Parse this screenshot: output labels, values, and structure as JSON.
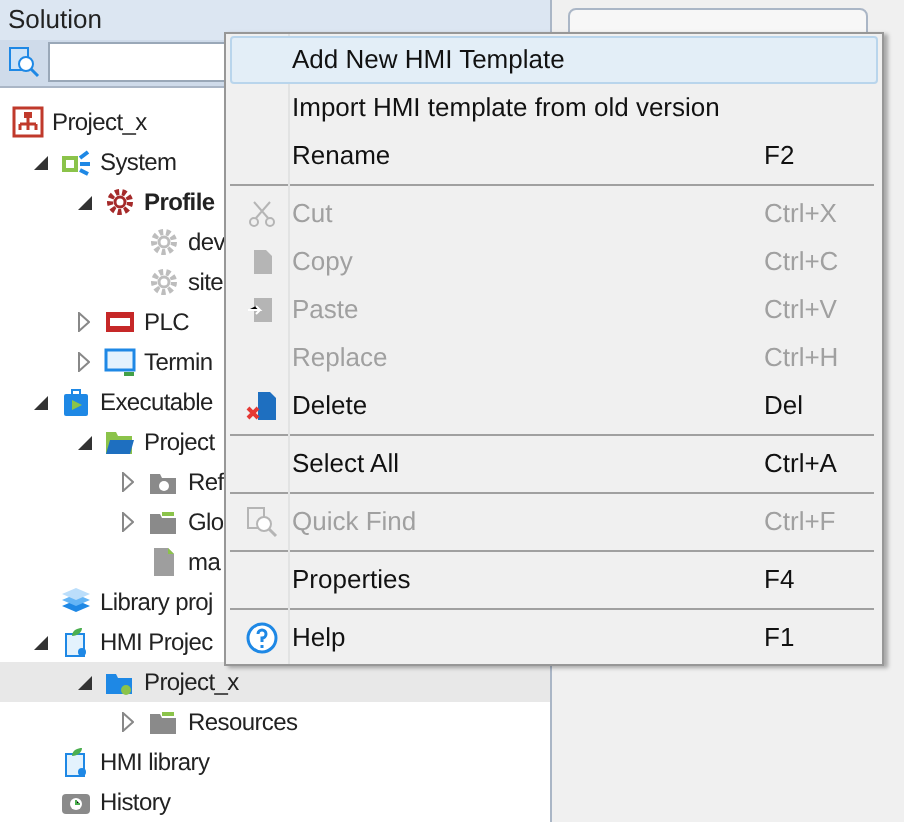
{
  "panel": {
    "title": "Solution"
  },
  "tree": [
    {
      "label": "Project_x",
      "kind": "project",
      "selected": false,
      "children": [
        {
          "label": "System",
          "kind": "system",
          "expanded": true,
          "selected": false,
          "children": [
            {
              "label": "Profile",
              "kind": "profile",
              "bold": true,
              "expanded": true,
              "selected": false,
              "children": [
                {
                  "label": "dev",
                  "kind": "gear",
                  "bold": false,
                  "selected": false
                },
                {
                  "label": "site",
                  "kind": "gear",
                  "bold": false,
                  "selected": false
                }
              ]
            },
            {
              "label": "PLC",
              "kind": "plc",
              "expanded": false,
              "selected": false
            },
            {
              "label": "Termin",
              "kind": "terminal",
              "expanded": false,
              "selected": false
            }
          ]
        },
        {
          "label": "Executable",
          "kind": "executable",
          "expanded": true,
          "selected": false,
          "children": [
            {
              "label": "Project",
              "kind": "openfolder",
              "expanded": true,
              "selected": false,
              "children": [
                {
                  "label": "Ref",
                  "kind": "refs",
                  "expanded": false,
                  "selected": false
                },
                {
                  "label": "Glo",
                  "kind": "folder",
                  "expanded": false,
                  "selected": false
                },
                {
                  "label": "ma",
                  "kind": "file",
                  "selected": false
                }
              ]
            }
          ]
        },
        {
          "label": "Library proj",
          "kind": "library",
          "selected": false
        },
        {
          "label": "HMI Projec",
          "kind": "hmi",
          "expanded": true,
          "selected": false,
          "children": [
            {
              "label": "Project_x",
              "kind": "hmiproject",
              "expanded": true,
              "selected": true,
              "children": [
                {
                  "label": "Resources",
                  "kind": "folder",
                  "expanded": false,
                  "selected": false
                }
              ]
            }
          ]
        },
        {
          "label": "HMI library",
          "kind": "hmi",
          "selected": false
        },
        {
          "label": "History",
          "kind": "history",
          "selected": false
        }
      ]
    }
  ],
  "menu": [
    {
      "kind": "item",
      "label": "Add New HMI Template",
      "selected": true,
      "disabled": false
    },
    {
      "kind": "item",
      "label": "Import HMI template from old version",
      "selected": false,
      "disabled": false
    },
    {
      "kind": "item",
      "label": "Rename",
      "shortcut": "F2",
      "selected": false,
      "disabled": false
    },
    {
      "kind": "separator"
    },
    {
      "kind": "cut",
      "label": "Cut",
      "shortcut": "Ctrl+X",
      "selected": false,
      "disabled": true
    },
    {
      "kind": "copy",
      "label": "Copy",
      "shortcut": "Ctrl+C",
      "selected": false,
      "disabled": true
    },
    {
      "kind": "paste",
      "label": "Paste",
      "shortcut": "Ctrl+V",
      "selected": false,
      "disabled": true
    },
    {
      "kind": "item",
      "label": "Replace",
      "shortcut": "Ctrl+H",
      "selected": false,
      "disabled": true
    },
    {
      "kind": "delete",
      "label": "Delete",
      "shortcut": "Del",
      "selected": false,
      "disabled": false
    },
    {
      "kind": "separator"
    },
    {
      "kind": "item",
      "label": "Select All",
      "shortcut": "Ctrl+A",
      "selected": false,
      "disabled": false
    },
    {
      "kind": "separator"
    },
    {
      "kind": "find",
      "label": "Quick Find",
      "shortcut": "Ctrl+F",
      "selected": false,
      "disabled": true
    },
    {
      "kind": "separator"
    },
    {
      "kind": "item",
      "label": "Properties",
      "shortcut": "F4",
      "selected": false,
      "disabled": false
    },
    {
      "kind": "separator"
    },
    {
      "kind": "help",
      "label": "Help",
      "shortcut": "F1",
      "selected": false,
      "disabled": false
    }
  ]
}
